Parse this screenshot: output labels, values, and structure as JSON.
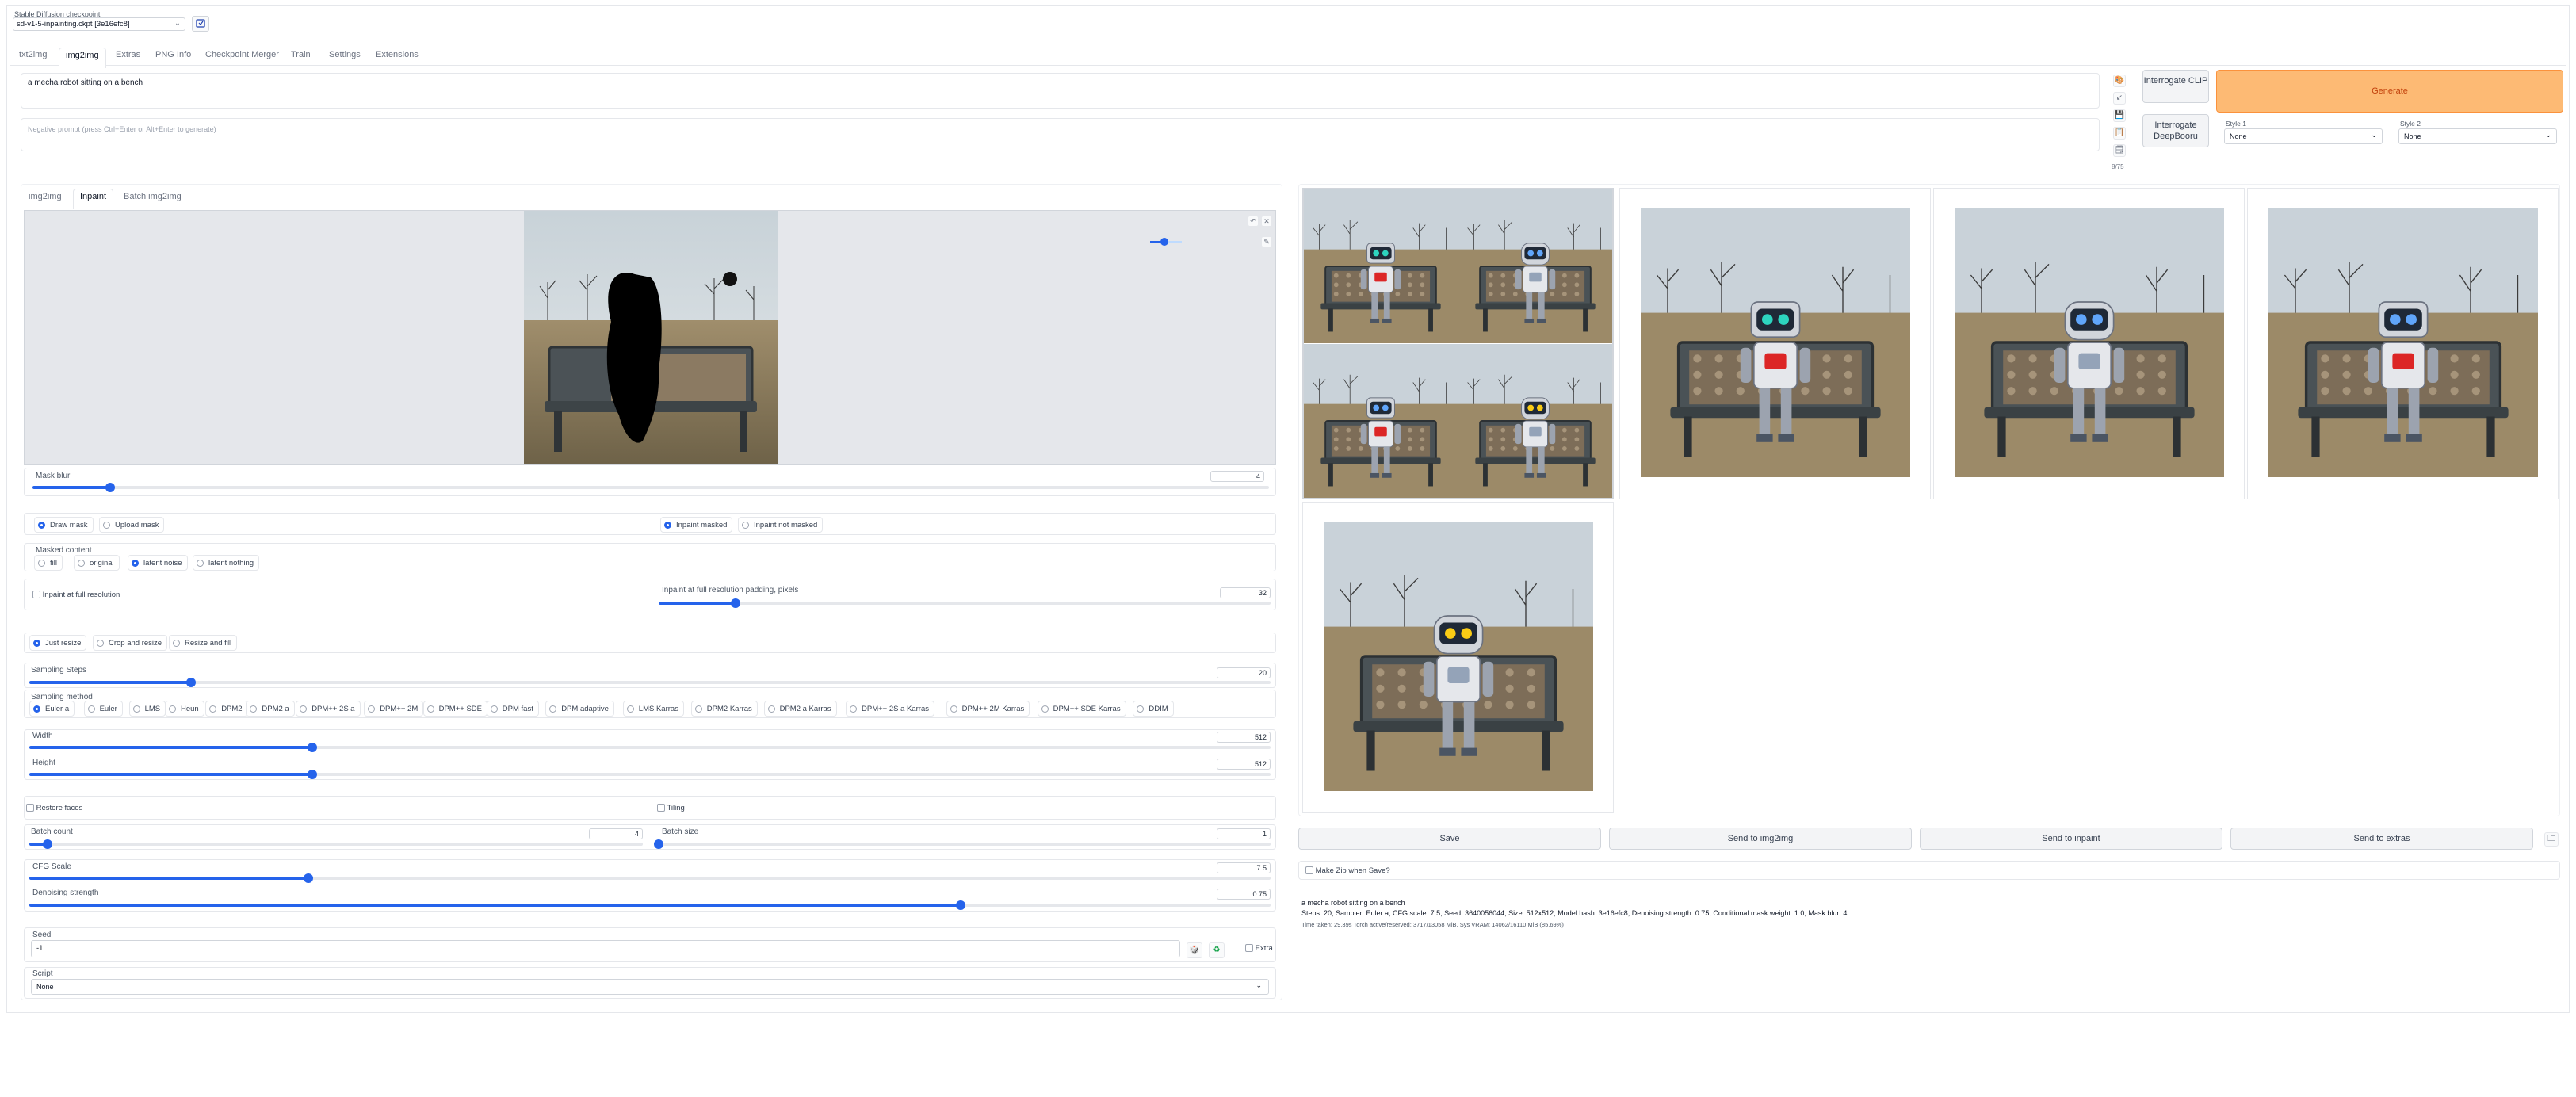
{
  "checkpoint": {
    "label": "Stable Diffusion checkpoint",
    "value": "sd-v1-5-inpainting.ckpt [3e16efc8]"
  },
  "main_tabs": [
    "txt2img",
    "img2img",
    "Extras",
    "PNG Info",
    "Checkpoint Merger",
    "Train",
    "Settings",
    "Extensions"
  ],
  "prompt": {
    "value": "a mecha robot sitting on a bench",
    "negative_placeholder": "Negative prompt (press Ctrl+Enter or Alt+Enter to generate)"
  },
  "toolbar": {
    "interrogate_clip": "Interrogate CLIP",
    "interrogate_deepbooru": "Interrogate DeepBooru",
    "generate": "Generate",
    "style1_label": "Style 1",
    "style1_value": "None",
    "style2_label": "Style 2",
    "style2_value": "None",
    "token_counter": "8/75",
    "icons": [
      "paint-palette-icon",
      "arrow-icon",
      "save-icon",
      "clipboard-icon",
      "clipboard-list-icon"
    ]
  },
  "sub_tabs": [
    "img2img",
    "Inpaint",
    "Batch img2img"
  ],
  "canvas": {
    "brush_size": 0.45
  },
  "mask_blur": {
    "label": "Mask blur",
    "value": "4",
    "fraction": 0.0625
  },
  "mask_mode": {
    "draw_mask": "Draw mask",
    "upload_mask": "Upload mask",
    "inpaint_masked": "Inpaint masked",
    "inpaint_not_masked": "Inpaint not masked"
  },
  "masked_content": {
    "label": "Masked content",
    "options": [
      "fill",
      "original",
      "latent noise",
      "latent nothing"
    ],
    "selected": 2
  },
  "full_res": {
    "checkbox": "Inpaint at full resolution",
    "padding_label": "Inpaint at full resolution padding, pixels",
    "padding_value": "32",
    "fraction": 0.125
  },
  "resize_mode": {
    "options": [
      "Just resize",
      "Crop and resize",
      "Resize and fill"
    ],
    "selected": 0
  },
  "sampling_steps": {
    "label": "Sampling Steps",
    "value": "20",
    "fraction": 0.13
  },
  "sampling_method": {
    "label": "Sampling method",
    "options": [
      "Euler a",
      "Euler",
      "LMS",
      "Heun",
      "DPM2",
      "DPM2 a",
      "DPM++ 2S a",
      "DPM++ 2M",
      "DPM++ SDE",
      "DPM fast",
      "DPM adaptive",
      "LMS Karras",
      "DPM2 Karras",
      "DPM2 a Karras",
      "DPM++ 2S a Karras",
      "DPM++ 2M Karras",
      "DPM++ SDE Karras",
      "DDIM"
    ],
    "selected": 0
  },
  "width": {
    "label": "Width",
    "value": "512",
    "fraction": 0.228
  },
  "height": {
    "label": "Height",
    "value": "512",
    "fraction": 0.228
  },
  "restore_faces": "Restore faces",
  "tiling": "Tiling",
  "batch_count": {
    "label": "Batch count",
    "value": "4",
    "fraction": 0.03
  },
  "batch_size": {
    "label": "Batch size",
    "value": "1",
    "fraction": 0.0
  },
  "cfg_scale": {
    "label": "CFG Scale",
    "value": "7.5",
    "fraction": 0.225
  },
  "denoising": {
    "label": "Denoising strength",
    "value": "0.75",
    "fraction": 0.75
  },
  "seed": {
    "label": "Seed",
    "value": "-1",
    "extra": "Extra"
  },
  "script": {
    "label": "Script",
    "value": "None"
  },
  "output_buttons": [
    "Save",
    "Send to img2img",
    "Send to inpaint",
    "Send to extras"
  ],
  "make_zip": "Make Zip when Save?",
  "info": {
    "prompt": "a mecha robot sitting on a bench",
    "params": "Steps: 20, Sampler: Euler a, CFG scale: 7.5, Seed: 3640056044, Size: 512x512, Model hash: 3e16efc8, Denoising strength: 0.75, Conditional mask weight: 1.0, Mask blur: 4",
    "time": "Time taken: 29.39s  Torch active/reserved: 3717/13058 MiB, Sys VRAM: 14062/16110 MiB (85.69%)"
  },
  "gallery": {
    "robot_eye_colors": [
      "#2dd4bf",
      "#60a5fa",
      "#60a5fa",
      "#facc15"
    ],
    "accent_colors": {
      "generate": "#fdba74",
      "primary": "#2563eb"
    }
  }
}
